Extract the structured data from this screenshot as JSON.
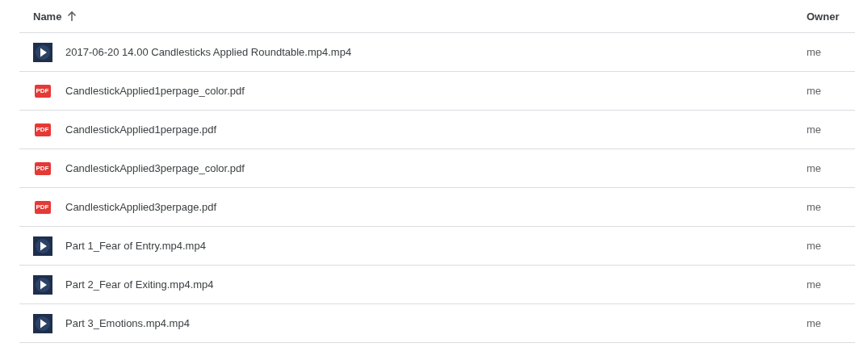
{
  "columns": [
    {
      "label": "Name",
      "sorted": true
    },
    {
      "label": "Owner",
      "sorted": false
    }
  ],
  "files": [
    {
      "kind": "video",
      "name": "2017-06-20 14.00 Candlesticks Applied Roundtable.mp4.mp4",
      "owner": "me"
    },
    {
      "kind": "pdf",
      "icon_label": "PDF",
      "name": "CandlestickApplied1perpage_color.pdf",
      "owner": "me"
    },
    {
      "kind": "pdf",
      "icon_label": "PDF",
      "name": "CandlestickApplied1perpage.pdf",
      "owner": "me"
    },
    {
      "kind": "pdf",
      "icon_label": "PDF",
      "name": "CandlestickApplied3perpage_color.pdf",
      "owner": "me"
    },
    {
      "kind": "pdf",
      "icon_label": "PDF",
      "name": "CandlestickApplied3perpage.pdf",
      "owner": "me"
    },
    {
      "kind": "video",
      "name": "Part 1_Fear of Entry.mp4.mp4",
      "owner": "me"
    },
    {
      "kind": "video",
      "name": "Part 2_Fear of Exiting.mp4.mp4",
      "owner": "me"
    },
    {
      "kind": "video",
      "name": "Part 3_Emotions.mp4.mp4",
      "owner": "me"
    }
  ]
}
